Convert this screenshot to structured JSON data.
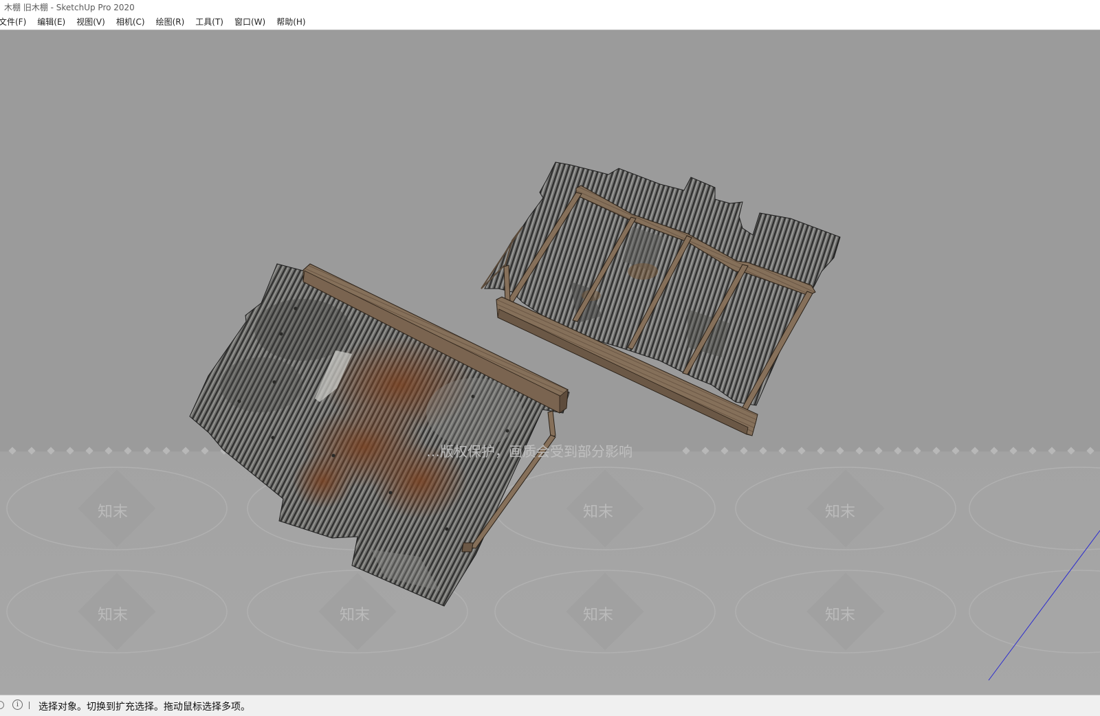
{
  "window": {
    "title": "木棚 旧木棚 - SketchUp Pro 2020"
  },
  "menubar": {
    "items": [
      {
        "label": "文件(F)",
        "name": "menu-file"
      },
      {
        "label": "编辑(E)",
        "name": "menu-edit"
      },
      {
        "label": "视图(V)",
        "name": "menu-view"
      },
      {
        "label": "相机(C)",
        "name": "menu-camera"
      },
      {
        "label": "绘图(R)",
        "name": "menu-draw"
      },
      {
        "label": "工具(T)",
        "name": "menu-tools"
      },
      {
        "label": "窗口(W)",
        "name": "menu-window"
      },
      {
        "label": "帮助(H)",
        "name": "menu-help"
      }
    ]
  },
  "viewport": {
    "background_color": "#9b9b9b",
    "watermark_notice": "…版权保护，画质会受到部分影响",
    "watermark_brand": "知末",
    "models": [
      "corrugated-shed-roof-left",
      "corrugated-shed-roof-right"
    ],
    "axis_color": "#2a2ad0"
  },
  "statusbar": {
    "info_icon": "info-circle-icon",
    "hint": "选择对象。切换到扩充选择。拖动鼠标选择多项。"
  }
}
